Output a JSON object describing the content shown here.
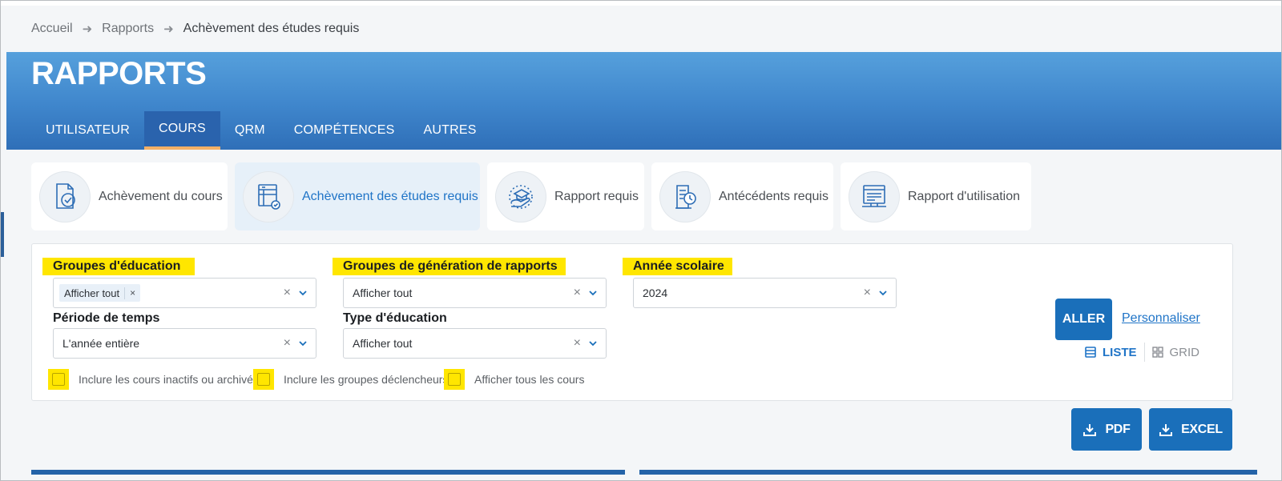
{
  "breadcrumb": {
    "home": "Accueil",
    "reports": "Rapports",
    "current": "Achèvement des études requis"
  },
  "header": {
    "title": "RAPPORTS"
  },
  "tabs": [
    {
      "label": "UTILISATEUR"
    },
    {
      "label": "COURS"
    },
    {
      "label": "QRM"
    },
    {
      "label": "COMPÉTENCES"
    },
    {
      "label": "AUTRES"
    }
  ],
  "report_cards": [
    {
      "label": "Achèvement du cours",
      "icon": "course-completion-icon"
    },
    {
      "label": "Achèvement des études requis",
      "icon": "required-studies-icon"
    },
    {
      "label": "Rapport requis",
      "icon": "required-report-icon"
    },
    {
      "label": "Antécédents requis",
      "icon": "required-history-icon"
    },
    {
      "label": "Rapport d'utilisation",
      "icon": "usage-report-icon"
    }
  ],
  "filters": {
    "education_groups": {
      "label": "Groupes d'éducation",
      "chip": "Afficher tout",
      "chip_remove": "×"
    },
    "report_groups": {
      "label": "Groupes de génération de rapports",
      "value": "Afficher tout"
    },
    "school_year": {
      "label": "Année scolaire",
      "value": "2024"
    },
    "time_period": {
      "label": "Période de temps",
      "value": "L'année entière"
    },
    "education_type": {
      "label": "Type d'éducation",
      "value": "Afficher tout"
    },
    "clear_symbol": "×"
  },
  "checkboxes": [
    {
      "label": "Inclure les cours inactifs ou archivés"
    },
    {
      "label": "Inclure les groupes déclencheurs"
    },
    {
      "label": "Afficher tous les cours"
    }
  ],
  "actions": {
    "go": "ALLER",
    "customize": "Personnaliser",
    "view_list": "LISTE",
    "view_grid": "GRID",
    "pdf": "PDF",
    "excel": "EXCEL"
  },
  "colors": {
    "primary": "#1a6fba",
    "highlight": "#ffe600",
    "tab_indicator": "#f4b066",
    "link": "#1f74c7"
  }
}
